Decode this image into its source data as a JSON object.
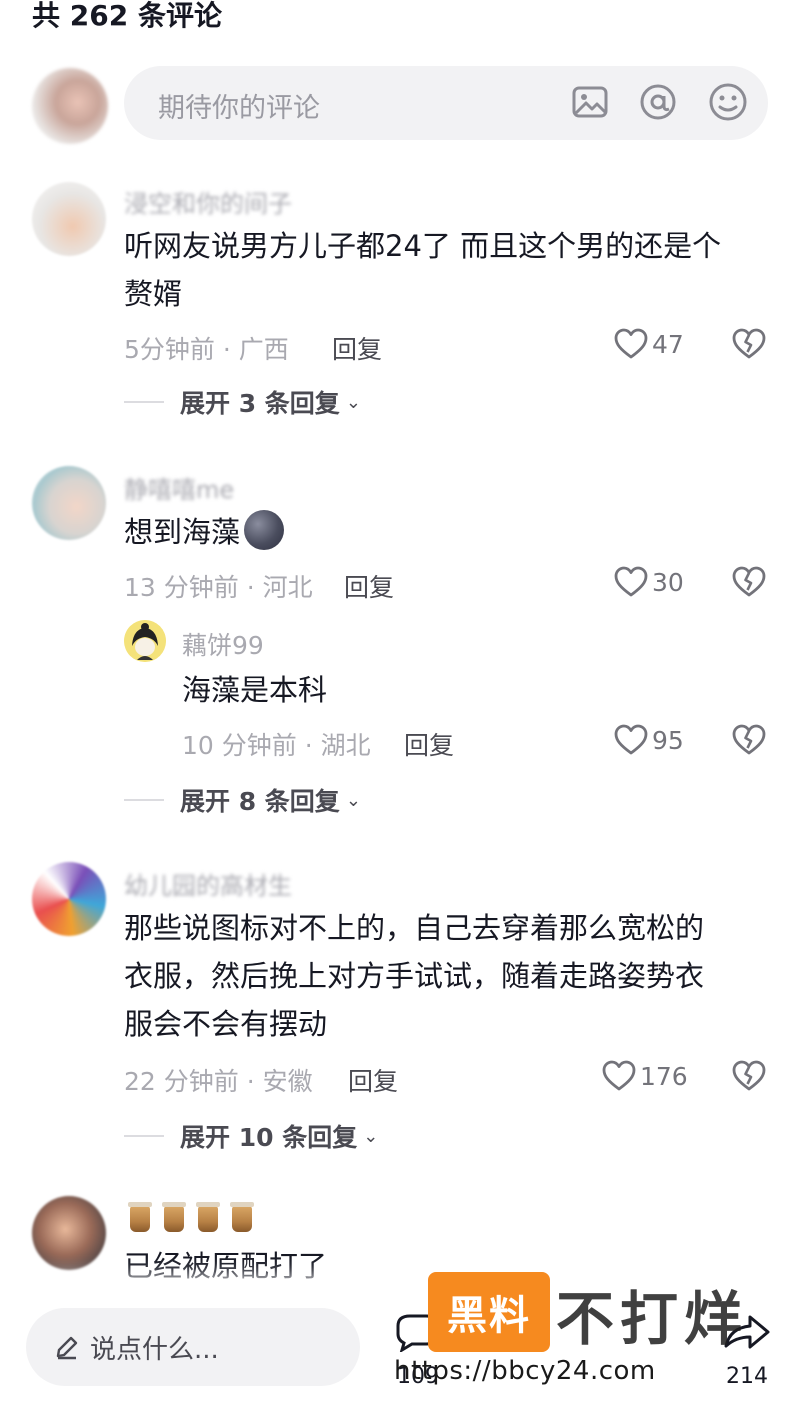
{
  "header": {
    "count_label": "共 262 条评论"
  },
  "composer": {
    "placeholder": "期待你的评论",
    "icons": [
      "image-icon",
      "at-icon",
      "emoji-icon"
    ]
  },
  "comments": [
    {
      "username": "浸空和你的间子",
      "text_lines": [
        "听网友说男方儿子都24了 而且这个男的还是个",
        "赘婿"
      ],
      "time_location": "5分钟前 · 广西",
      "reply_label": "回复",
      "likes": "47",
      "expand_label": "展开 3 条回复"
    },
    {
      "username": "静嘻嘻me",
      "text": "想到海藻",
      "time_location": "13 分钟前 · 河北",
      "reply_label": "回复",
      "likes": "30",
      "sub_reply": {
        "username": "藕饼99",
        "text": "海藻是本科",
        "time_location": "10 分钟前 · 湖北",
        "reply_label": "回复",
        "likes": "95"
      },
      "expand_label": "展开 8 条回复"
    },
    {
      "username": "幼儿园的高材生",
      "text_lines": [
        "那些说图标对不上的，自己去穿着那么宽松的",
        "衣服，然后挽上对方手试试，随着走路姿势衣",
        "服会不会有摆动"
      ],
      "time_location": "22 分钟前 · 安徽",
      "reply_label": "回复",
      "likes": "176",
      "expand_label": "展开 10 条回复"
    },
    {
      "username_emoji": "bubble-tea x4",
      "text": "已经被原配打了"
    }
  ],
  "bottom_bar": {
    "say_placeholder": "说点什么...",
    "left_count": "109",
    "right_count": "214"
  },
  "watermark": {
    "logo_text": "黑料",
    "text": "不打烊",
    "url": "https://bbcy24.com"
  },
  "colors": {
    "text": "#161823",
    "muted": "#a9a9b0",
    "input_bg": "#f2f2f4",
    "watermark_orange": "#f68a1f"
  }
}
